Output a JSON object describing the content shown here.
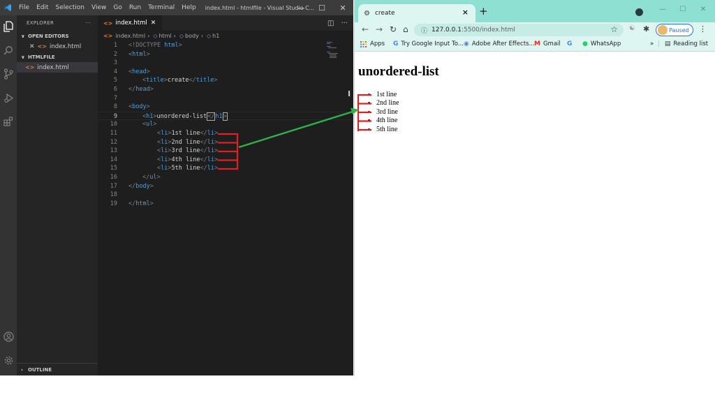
{
  "vscode": {
    "menu": [
      "File",
      "Edit",
      "Selection",
      "View",
      "Go",
      "Run",
      "Terminal",
      "Help"
    ],
    "window_title": "index.html - htmlfile - Visual Studio C...",
    "sidebar": {
      "header": "EXPLORER",
      "header_more": "···",
      "open_editors_label": "OPEN EDITORS",
      "open_editor_file": "index.html",
      "folder_label": "HTMLFILE",
      "folder_file": "index.html",
      "outline_label": "OUTLINE"
    },
    "tab": {
      "label": "index.html"
    },
    "breadcrumb": [
      "index.html",
      "html",
      "body",
      "h1"
    ],
    "line_numbers": [
      "1",
      "2",
      "3",
      "4",
      "5",
      "6",
      "7",
      "8",
      "9",
      "10",
      "11",
      "12",
      "13",
      "14",
      "15",
      "16",
      "17",
      "18",
      "19"
    ],
    "code": {
      "l1_a": "<!DOCTYPE ",
      "l1_b": "html",
      "l1_c": ">",
      "l2_a": "<",
      "l2_b": "html",
      "l2_c": ">",
      "l4_a": "<",
      "l4_b": "head",
      "l4_c": ">",
      "l5_title_open": "title",
      "l5_text": "create",
      "l5_title_close": "title",
      "l6_b": "head",
      "l8_b": "body",
      "l9_tag": "h1",
      "l9_text": "unordered-list",
      "l9_close_a": "</",
      "l9_close_b": "h1",
      "l9_close_c": ">",
      "l10_b": "ul",
      "li_tag": "li",
      "items": [
        "1st line",
        "2nd line",
        "3rd line",
        "4th line",
        "5th line"
      ],
      "l16_b": "ul",
      "l17_b": "body",
      "l19_b": "html"
    }
  },
  "chrome": {
    "tab_title": "create",
    "tab_close": "×",
    "new_tab": "+",
    "url_host": "127.0.0.1",
    "url_rest": ":5500/index.html",
    "profile_status": "Paused",
    "bookmarks": [
      "Apps",
      "Try Google Input To...",
      "Adobe After Effects...",
      "Gmail",
      "WhatsApp"
    ],
    "bookmarks_overflow": "»",
    "reading_list": "Reading list"
  },
  "page": {
    "heading": "unordered-list",
    "items": [
      "1st line",
      "2nd line",
      "3rd line",
      "4th line",
      "5th line"
    ]
  },
  "annotation_colors": {
    "bracket": "#e02020",
    "arrow": "#2db34a"
  }
}
